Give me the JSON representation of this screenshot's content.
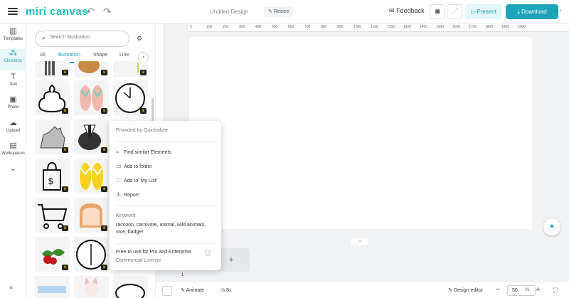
{
  "topbar": {
    "logo": "miri canvas",
    "document_title": "Untitled Design",
    "resize_label": "Resize",
    "feedback_label": "Feedback",
    "present_label": "Present",
    "download_label": "Download"
  },
  "rail": {
    "items": [
      {
        "label": "Templates",
        "icon": "templates-icon"
      },
      {
        "label": "Elements",
        "icon": "elements-icon"
      },
      {
        "label": "Text",
        "icon": "text-icon"
      },
      {
        "label": "Photo",
        "icon": "photo-icon"
      },
      {
        "label": "Upload",
        "icon": "upload-icon"
      },
      {
        "label": "Workspaces",
        "icon": "workspaces-icon"
      }
    ]
  },
  "panel": {
    "search_placeholder": "Search Illustration",
    "tabs": [
      "All",
      "Illustration",
      "Shape",
      "Line"
    ]
  },
  "ruler": {
    "ticks": [
      "0",
      "100",
      "200",
      "300",
      "400",
      "500",
      "600",
      "700",
      "800",
      "900",
      "1000",
      "1100",
      "1200",
      "1300",
      "1400",
      "1500",
      "1600",
      "1700",
      "1800",
      "1900",
      "2000"
    ]
  },
  "popup": {
    "provided_by": "Provided by Quicksilver",
    "menu": [
      "Find similar Elements",
      "Add to folder",
      "Add to 'My List'",
      "Report"
    ],
    "keyword_title": "Keyword",
    "keywords": "raccoon, carnivore, animal, wild animals, nice, badger",
    "free_text": "Free to use for Pro and Enterprise",
    "license": "Commercial License"
  },
  "pages": {
    "page_number": "1"
  },
  "bottombar": {
    "animate_label": "Animate",
    "duration_label": "5s",
    "design_editor_label": "Design editor",
    "zoom_value": "50",
    "zoom_unit": "%"
  },
  "colors": {
    "accent": "#1ea3b8",
    "accent_light": "#e3f6f8"
  }
}
